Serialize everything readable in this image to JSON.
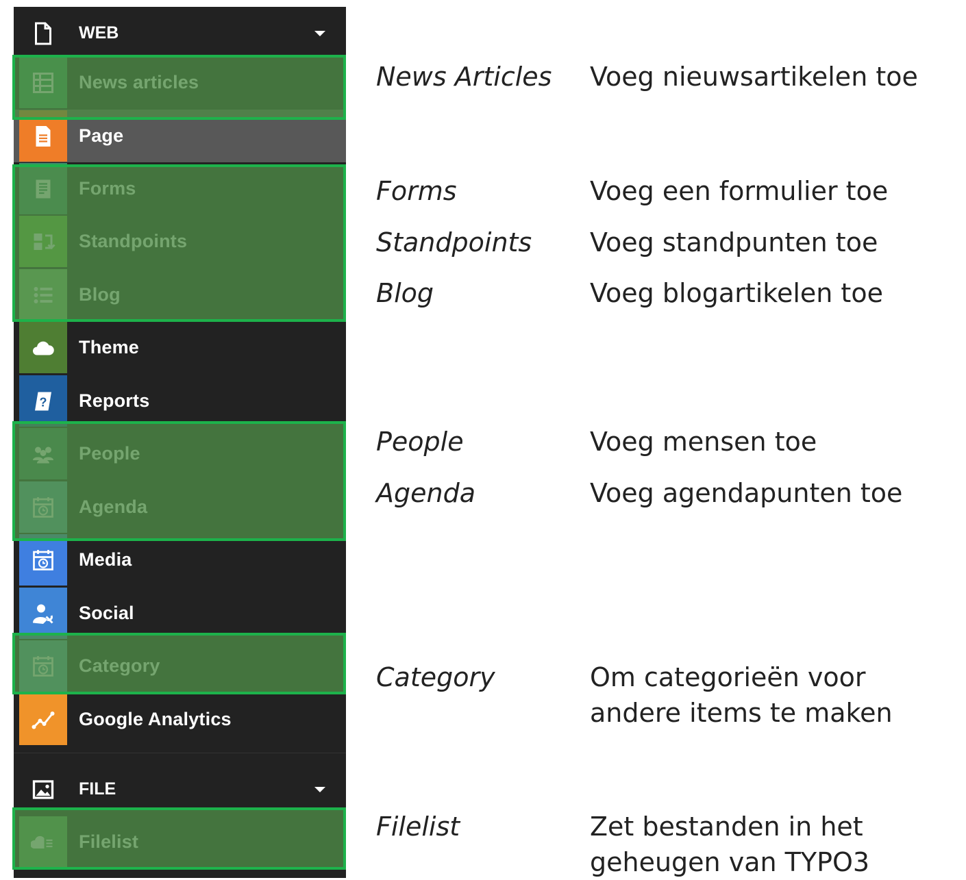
{
  "sidebar": {
    "web_section": {
      "label": "WEB",
      "icon": "document-icon"
    },
    "file_section": {
      "label": "FILE",
      "icon": "image-icon"
    },
    "items": [
      {
        "label": "News articles",
        "icon": "list-table-icon",
        "color": "#3aa05a"
      },
      {
        "label": "Page",
        "icon": "page-icon",
        "color": "#ef7d28"
      },
      {
        "label": "Forms",
        "icon": "form-icon",
        "color": "#3f8f6a"
      },
      {
        "label": "Standpoints",
        "icon": "standpoints-icon",
        "color": "#6bbf3a"
      },
      {
        "label": "Blog",
        "icon": "bullet-list-icon",
        "color": "#7fbf73"
      },
      {
        "label": "Theme",
        "icon": "cloud-icon",
        "color": "#4f7e33"
      },
      {
        "label": "Reports",
        "icon": "help-book-icon",
        "color": "#1f5f9f"
      },
      {
        "label": "People",
        "icon": "people-icon",
        "color": "#3b7f5f"
      },
      {
        "label": "Agenda",
        "icon": "calendar-icon",
        "color": "#5aa3ad"
      },
      {
        "label": "Media",
        "icon": "calendar-icon",
        "color": "#3f7fe0"
      },
      {
        "label": "Social",
        "icon": "user-wrench-icon",
        "color": "#3f85d6"
      },
      {
        "label": "Category",
        "icon": "calendar-icon",
        "color": "#5aa3ad"
      },
      {
        "label": "Google Analytics",
        "icon": "analytics-icon",
        "color": "#f0932a"
      }
    ],
    "file_items": [
      {
        "label": "Filelist",
        "icon": "filelist-icon",
        "color": "#5ea85a"
      }
    ]
  },
  "annotations": [
    {
      "term": "News Articles",
      "text": "Voeg nieuwsartikelen toe"
    },
    {
      "term": "Forms",
      "text": "Voeg een formulier toe"
    },
    {
      "term": "Standpoints",
      "text": "Voeg standpunten toe"
    },
    {
      "term": "Blog",
      "text": "Voeg blogartikelen toe"
    },
    {
      "term": "People",
      "text": "Voeg mensen toe"
    },
    {
      "term": "Agenda",
      "text": "Voeg agendapunten toe"
    },
    {
      "term": "Category",
      "text": "Om categorieën voor andere items te maken"
    },
    {
      "term": "Filelist",
      "text": "Zet bestanden in het geheugen van TYPO3"
    }
  ],
  "highlight_color": "#1db24b"
}
